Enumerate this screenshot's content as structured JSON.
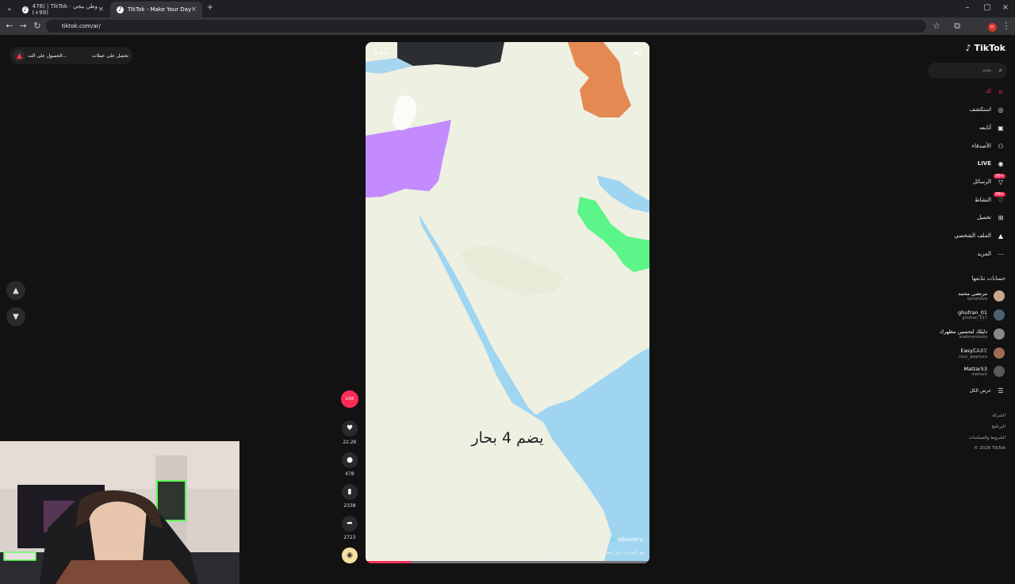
{
  "browser": {
    "tabs": [
      {
        "title": "476) | TikTok - وطن بيجي (99+)",
        "active": false
      },
      {
        "title": "TikTok - Make Your Day",
        "active": true
      }
    ],
    "url": "tiktok.com/ar/",
    "new_tab": "+"
  },
  "banner": {
    "left_text": "الحصول على الت...",
    "right_text": "تحصل على عملات"
  },
  "video": {
    "overlay_text": "يضم 4 بحار",
    "handle": "aljazeera",
    "caption": "مع التوترات في مضيق هرمز يعود الحديث حول مشروع \"البحار الأربعة\" الذي طرحه الرئيس التركي السابق \"عبد الله... المزيد",
    "progress": 0.16
  },
  "actions": [
    {
      "name": "like",
      "icon": "heart-icon",
      "count": "22.2K"
    },
    {
      "name": "comment",
      "icon": "comment-icon",
      "count": "478"
    },
    {
      "name": "save",
      "icon": "bookmark-icon",
      "count": "2338"
    },
    {
      "name": "share",
      "icon": "share-icon",
      "count": "2723"
    }
  ],
  "live_badge": "LIVE",
  "sidebar": {
    "brand": "TikTok",
    "search_placeholder": "بحث",
    "nav": [
      {
        "label": "لك",
        "icon": "home-icon"
      },
      {
        "label": "استكشف",
        "icon": "compass-icon"
      },
      {
        "label": "أتابعه",
        "icon": "following-icon"
      },
      {
        "label": "الأصدقاء",
        "icon": "friends-icon"
      },
      {
        "label": "LIVE",
        "icon": "live-icon"
      },
      {
        "label": "الرسائل",
        "icon": "messages-icon",
        "badge": "99+"
      },
      {
        "label": "النشاط",
        "icon": "activity-icon",
        "badge": "99+"
      },
      {
        "label": "تحميل",
        "icon": "upload-icon"
      },
      {
        "label": "الملف الشخصي",
        "icon": "profile-icon"
      },
      {
        "label": "المزيد",
        "icon": "more-icon"
      }
    ],
    "following_title": "حسابات تتابعها",
    "accounts": [
      {
        "name": "مرتضى محمد",
        "handle": "iqmorteza"
      },
      {
        "name": "ghufran_01",
        "handle": "ghufran_017"
      },
      {
        "name": "دليلك لتحسين مظهرك",
        "handle": "arabmenlooks"
      },
      {
        "name": "Easy𝙴𝙰𝚂𝚈",
        "handle": "nour_qaqmsra"
      },
      {
        "name": "Mattar53",
        "handle": "mattarx"
      }
    ],
    "see_all": "عرض الكل",
    "footer": [
      "الشركة",
      "البرنامج",
      "الشروط والسياسات",
      "© 2026 TikTok"
    ]
  }
}
